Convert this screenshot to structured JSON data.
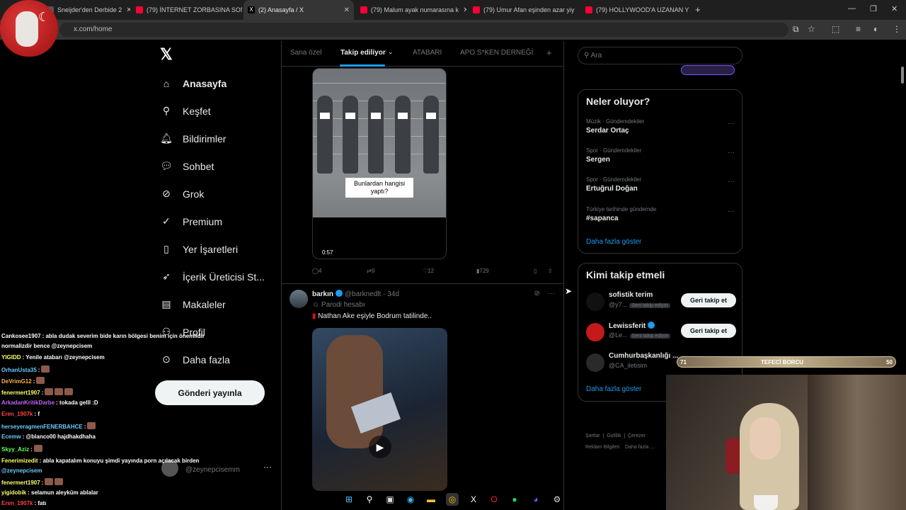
{
  "browser": {
    "tabs": [
      {
        "title": "Sneijder'den Derbide 2",
        "color": "#555555"
      },
      {
        "title": "(79) İNTERNET ZORBASINA SON",
        "color": "#ff0033"
      },
      {
        "title": "(2) Anasayfa / X",
        "color": "#ffffff"
      },
      {
        "title": "(79) Malum ayak numarasına k",
        "color": "#ff0033"
      },
      {
        "title": "(79) Umur Afan eşinden azar yiy",
        "color": "#ff0033"
      },
      {
        "title": "(79) HOLLYWOOD'A UZANAN Y",
        "color": "#ff0033"
      }
    ],
    "url": "x.com/home"
  },
  "nav": {
    "items": [
      {
        "label": "Anasayfa",
        "icon": "home-icon"
      },
      {
        "label": "Keşfet",
        "icon": "search-icon"
      },
      {
        "label": "Bildirimler",
        "icon": "bell-icon"
      },
      {
        "label": "Sohbet",
        "icon": "chat-icon"
      },
      {
        "label": "Grok",
        "icon": "grok-icon"
      },
      {
        "label": "Premium",
        "icon": "premium-icon"
      },
      {
        "label": "Yer İşaretleri",
        "icon": "bookmark-icon"
      },
      {
        "label": "İçerik Üreticisi St...",
        "icon": "rocket-icon"
      },
      {
        "label": "Makaleler",
        "icon": "article-icon"
      },
      {
        "label": "Profil",
        "icon": "person-icon"
      },
      {
        "label": "Daha fazla",
        "icon": "more-circle-icon"
      }
    ],
    "post_button": "Gönderi yayınla",
    "account_handle": "@zeynepcisemm"
  },
  "feed": {
    "tabs": [
      "Sana özel",
      "Takip ediliyor",
      "ATABARI",
      "APO S*KEN DERNEĞİ"
    ],
    "tweet1": {
      "media_caption": "Bunlardan hangisi yaptı?",
      "duration": "0:57",
      "replies": "4",
      "reposts": "9",
      "likes": "12",
      "views": "729"
    },
    "tweet2": {
      "name": "barkın",
      "handle": "@barknedlt",
      "time": "34d",
      "label": "Parodi hesabı",
      "text": "Nathan Ake eşiyle Bodrum tatilinde.."
    }
  },
  "sidebar": {
    "search_placeholder": "Ara",
    "trends_title": "Neler oluyor?",
    "trends": [
      {
        "category": "Müzik · Gündemdekiler",
        "name": "Serdar Ortaç"
      },
      {
        "category": "Spor · Gündemdekiler",
        "name": "Sergen"
      },
      {
        "category": "Spor · Gündemdekiler",
        "name": "Ertuğrul Doğan"
      },
      {
        "category": "Türkiye tarihinde gündemde",
        "name": "#sapanca"
      }
    ],
    "show_more": "Daha fazla göster",
    "who_title": "Kimi takip etmeli",
    "who": [
      {
        "name": "sofistik terim",
        "handle": "@y7...",
        "badge": "Seni takip ediyor",
        "button": "Geri takip et"
      },
      {
        "name": "Lewissferit",
        "handle": "@Le...",
        "badge": "Seni takip ediyor",
        "button": "Geri takip et"
      },
      {
        "name": "Cumhurbaşkanlığı ...",
        "handle": "@CA_iletisim",
        "badge": "",
        "button": ""
      }
    ],
    "who_show_more": "Daha fazla göster",
    "footer": [
      "Şartlar",
      "Gizlilik",
      "Çerezer",
      "Reklam Bilgileri",
      "Daha fazla ..."
    ]
  },
  "stream": {
    "bar_left": "71",
    "bar_title": "TEFECİ BORCU",
    "bar_right": "50",
    "chat": [
      {
        "user": "Cankosee1907",
        "msg": ": abla dudak severim bide karın bölgesi benim için önemlidir",
        "color": "#ffffff"
      },
      {
        "user": "",
        "msg": "normalizdir bence @zeynepcisem",
        "color": "#ffffff"
      },
      {
        "user": "YIGIDD",
        "msg": ": Yenile atabarı @zeynepcisem",
        "color": "#ffff66"
      },
      {
        "user": "OrhanUsta35",
        "msg": ":",
        "color": "#66ccff"
      },
      {
        "user": "DeVrimG12",
        "msg": ":",
        "color": "#ffb347"
      },
      {
        "user": "fenermert1907",
        "msg": ":",
        "color": "#ffff66"
      },
      {
        "user": "ArkadanKritikDarbe",
        "msg": ": tokada gelll :D",
        "color": "#c060ff"
      },
      {
        "user": "Eren_1907k",
        "msg": ": f",
        "color": "#ff4444"
      },
      {
        "user": "herseyeragmenFENERBAHCE",
        "msg": ":",
        "color": "#66ccff"
      },
      {
        "user": "Ecemw",
        "msg": ": @blanco00 hajdhakdhaha",
        "color": "#66ccff"
      },
      {
        "user": "Skyy_Aziz",
        "msg": ":",
        "color": "#66ff66"
      },
      {
        "user": "Fenerimizedit",
        "msg": ": abla kapatalım konuyu şimdi yayında porn açılacak birden",
        "color": "#ffff66"
      },
      {
        "user": "",
        "msg": "@zeynepcisem",
        "color": "#ffffff"
      },
      {
        "user": "fenermert1907",
        "msg": ":",
        "color": "#ffff66"
      },
      {
        "user": "yigidobik",
        "msg": ": selamun aleyküm ablalar",
        "color": "#ffff66"
      },
      {
        "user": "Eren_1907k",
        "msg": ": fatı",
        "color": "#ff4444"
      }
    ]
  }
}
